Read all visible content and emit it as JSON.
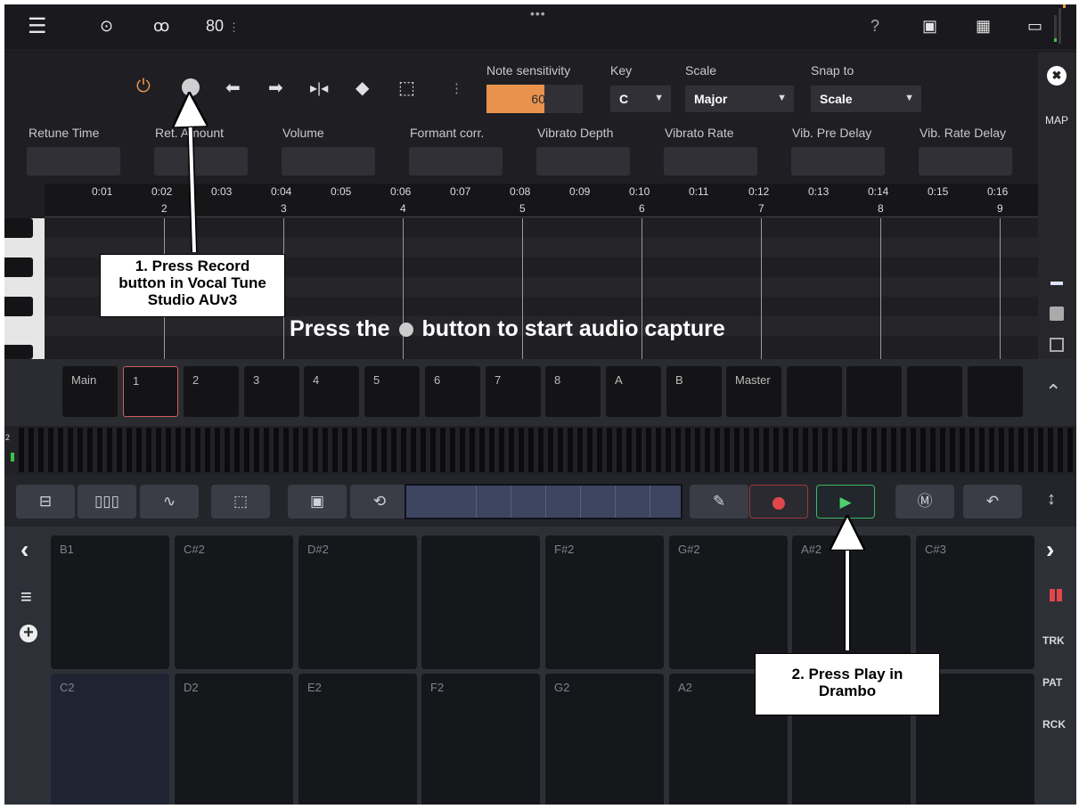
{
  "host_bar": {
    "tempo": "80",
    "tempo_caret": "⋮",
    "more": "•••",
    "help": "?"
  },
  "toolbar": {
    "more": "⋮"
  },
  "note_sensitivity": {
    "label": "Note sensitivity",
    "value": "60",
    "fraction": 0.6
  },
  "key": {
    "label": "Key",
    "value": "C"
  },
  "scale": {
    "label": "Scale",
    "value": "Major"
  },
  "snap": {
    "label": "Snap to",
    "value": "Scale"
  },
  "params": [
    "Retune Time",
    "Ret. Amount",
    "Volume",
    "Formant corr.",
    "Vibrato Depth",
    "Vibrato Rate",
    "Vib. Pre Delay",
    "Vib. Rate Delay"
  ],
  "plugin_side": {
    "close": "✖",
    "map": "MAP"
  },
  "ruler": {
    "times": [
      "0:01",
      "0:02",
      "0:03",
      "0:04",
      "0:05",
      "0:06",
      "0:07",
      "0:08",
      "0:09",
      "0:10",
      "0:11",
      "0:12",
      "0:13",
      "0:14",
      "0:15",
      "0:16"
    ],
    "bars": [
      "2",
      "3",
      "4",
      "5",
      "6",
      "7",
      "8",
      "9"
    ]
  },
  "hint": {
    "before": "Press the",
    "after": "button to start audio capture"
  },
  "tracks": [
    "Main",
    "1",
    "2",
    "3",
    "4",
    "5",
    "6",
    "7",
    "8",
    "A",
    "B",
    "Master",
    "",
    "",
    "",
    ""
  ],
  "strip_marker": "2",
  "pads": {
    "top": [
      "B1",
      "C#2",
      "D#2",
      "",
      "F#2",
      "G#2",
      "A#2",
      "C#3"
    ],
    "bottom": [
      "C2",
      "D2",
      "E2",
      "F2",
      "G2",
      "A2",
      "",
      ""
    ]
  },
  "side_right": {
    "trk": "TRK",
    "pat": "PAT",
    "rck": "RCK"
  },
  "annotations": {
    "record": [
      "1. Press Record",
      "button in Vocal Tune",
      "Studio AUv3"
    ],
    "play": [
      "2. Press Play in",
      "Drambo"
    ]
  }
}
